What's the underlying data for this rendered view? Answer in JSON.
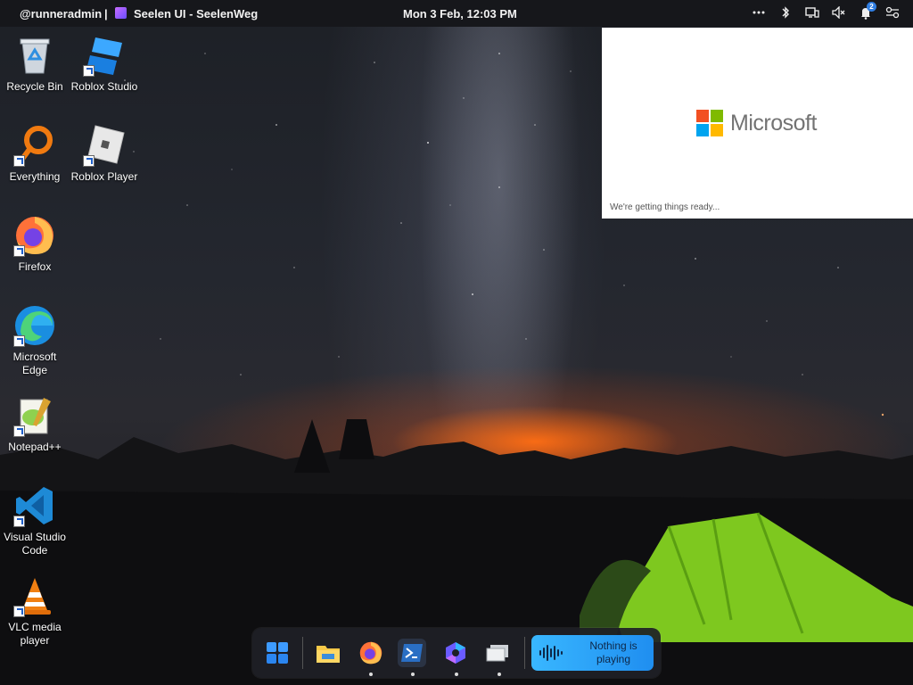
{
  "topbar": {
    "user": "@runneradmin",
    "separator": "|",
    "active_app": "Seelen UI  -  SeelenWeg",
    "clock": "Mon 3 Feb, 12:03 PM",
    "notification_count": "2",
    "icons": [
      "more-icon",
      "bluetooth-icon",
      "display-icon",
      "volume-muted-icon",
      "notifications-icon",
      "settings-toggle-icon"
    ]
  },
  "desktop": {
    "icons": [
      {
        "label": "Recycle Bin",
        "icon": "recycle-bin-icon"
      },
      {
        "label": "Roblox Studio",
        "icon": "roblox-studio-icon"
      },
      {
        "label": "Everything",
        "icon": "everything-search-icon"
      },
      {
        "label": "Roblox Player",
        "icon": "roblox-player-icon"
      },
      {
        "label": "Firefox",
        "icon": "firefox-icon"
      },
      {
        "label": "Microsoft Edge",
        "icon": "edge-icon"
      },
      {
        "label": "Notepad++",
        "icon": "notepad-plus-plus-icon"
      },
      {
        "label": "Visual Studio Code",
        "icon": "vscode-icon"
      },
      {
        "label": "VLC media player",
        "icon": "vlc-icon"
      }
    ]
  },
  "ms_window": {
    "brand": "Microsoft",
    "status": "We're getting things ready...",
    "logo_colors": [
      "#f25022",
      "#7fba00",
      "#00a4ef",
      "#ffb900"
    ]
  },
  "dock": {
    "items": [
      "start-menu-icon",
      "file-explorer-icon",
      "firefox-icon",
      "powershell-icon",
      "copilot-icon",
      "app-icon"
    ],
    "media_text": "Nothing is playing"
  }
}
